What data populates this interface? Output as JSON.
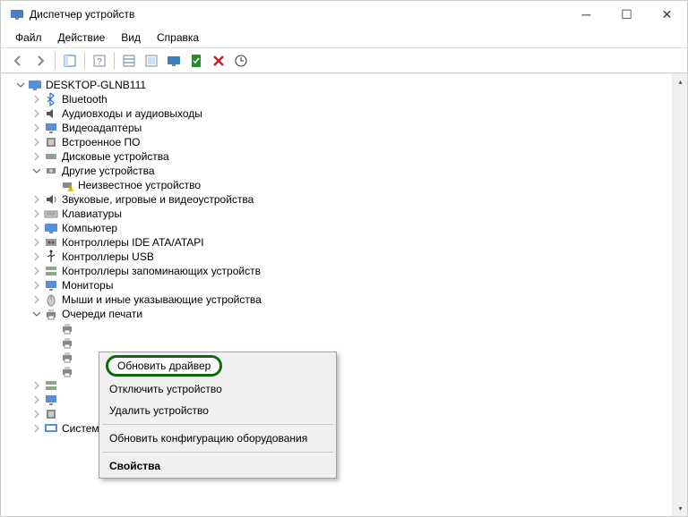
{
  "window": {
    "title": "Диспетчер устройств"
  },
  "menu": {
    "file": "Файл",
    "action": "Действие",
    "view": "Вид",
    "help": "Справка"
  },
  "tree": {
    "root": "DESKTOP-GLNB111",
    "items": [
      {
        "label": "Bluetooth",
        "icon": "bluetooth"
      },
      {
        "label": "Аудиовходы и аудиовыходы",
        "icon": "audio"
      },
      {
        "label": "Видеоадаптеры",
        "icon": "display"
      },
      {
        "label": "Встроенное ПО",
        "icon": "firmware"
      },
      {
        "label": "Дисковые устройства",
        "icon": "disk"
      },
      {
        "label": "Другие устройства",
        "icon": "other",
        "expanded": true,
        "children": [
          {
            "label": "Неизвестное устройство",
            "icon": "warning"
          }
        ]
      },
      {
        "label": "Звуковые, игровые и видеоустройства",
        "icon": "sound"
      },
      {
        "label": "Клавиатуры",
        "icon": "keyboard"
      },
      {
        "label": "Компьютер",
        "icon": "computer"
      },
      {
        "label": "Контроллеры IDE ATA/ATAPI",
        "icon": "ide"
      },
      {
        "label": "Контроллеры USB",
        "icon": "usb"
      },
      {
        "label": "Контроллеры запоминающих устройств",
        "icon": "storage"
      },
      {
        "label": "Мониторы",
        "icon": "monitor"
      },
      {
        "label": "Мыши и иные указывающие устройства",
        "icon": "mouse"
      },
      {
        "label": "Очереди печати",
        "icon": "printer",
        "expanded": true
      },
      {
        "label": "Системные устройства",
        "icon": "system"
      }
    ],
    "printer_hidden": [
      "",
      "",
      "",
      ""
    ]
  },
  "context": {
    "update": "Обновить драйвер",
    "disable": "Отключить устройство",
    "uninstall": "Удалить устройство",
    "scan": "Обновить конфигурацию оборудования",
    "props": "Свойства"
  }
}
